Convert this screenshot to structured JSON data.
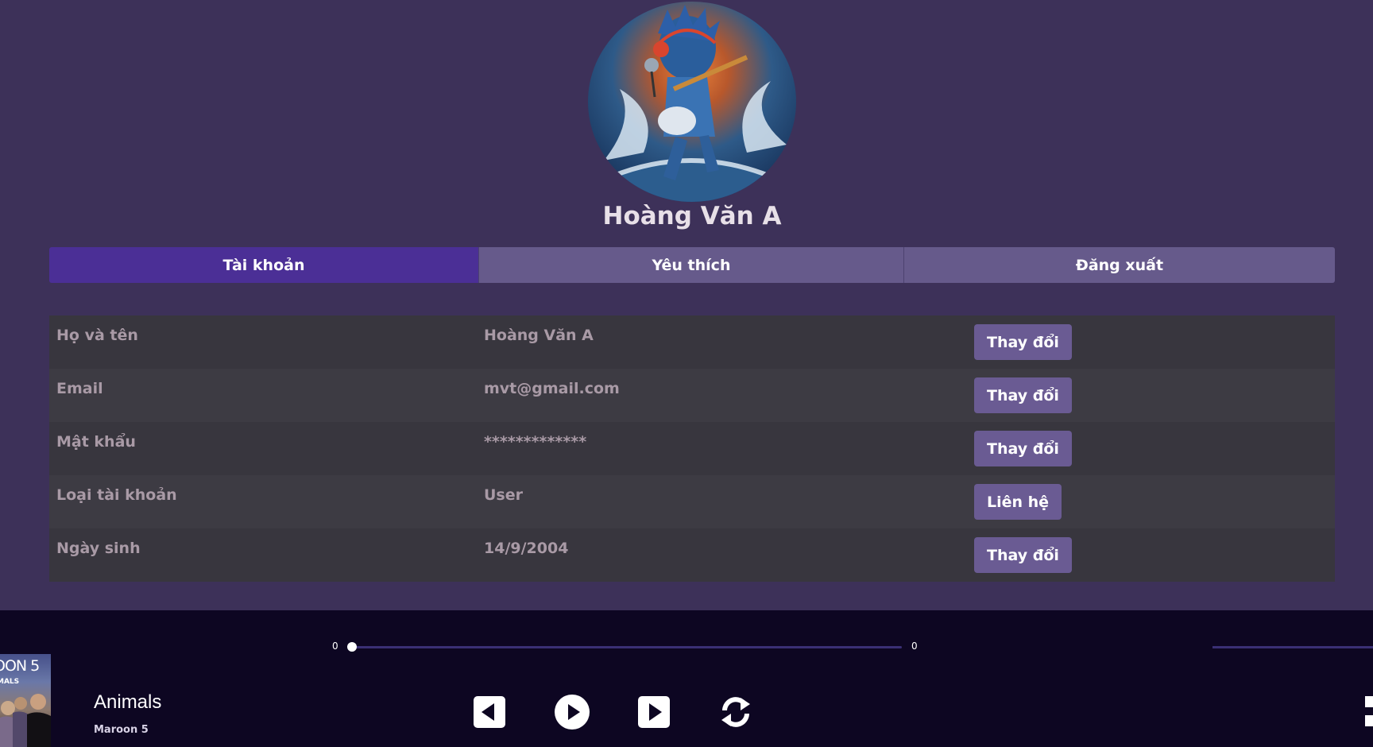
{
  "profile": {
    "name": "Hoàng Văn A"
  },
  "tabs": [
    {
      "label": "Tài khoản",
      "active": true
    },
    {
      "label": "Yêu thích",
      "active": false
    },
    {
      "label": "Đăng xuất",
      "active": false
    }
  ],
  "info_rows": [
    {
      "label": "Họ và tên",
      "value": "Hoàng Văn A",
      "action": "Thay đổi"
    },
    {
      "label": "Email",
      "value": "mvt@gmail.com",
      "action": "Thay đổi"
    },
    {
      "label": "Mật khẩu",
      "value": "*************",
      "action": "Thay đổi"
    },
    {
      "label": "Loại tài khoản",
      "value": "User",
      "action": "Liên hệ"
    },
    {
      "label": "Ngày sinh",
      "value": "14/9/2004",
      "action": "Thay đổi"
    }
  ],
  "player": {
    "current_time": "0",
    "duration": "0",
    "progress": 0,
    "song_title": "Animals",
    "artist": "Maroon 5",
    "album_art_text": "OON 5",
    "album_art_subtext": "MALS",
    "controls": [
      "previous-icon",
      "play-icon",
      "next-icon",
      "repeat-icon"
    ]
  },
  "colors": {
    "page_bg": "#3d3159",
    "tab_active": "#4b2f96",
    "tab_inactive": "#665a8b",
    "button_bg": "#6a5b93",
    "player_bg": "#0d0622"
  }
}
